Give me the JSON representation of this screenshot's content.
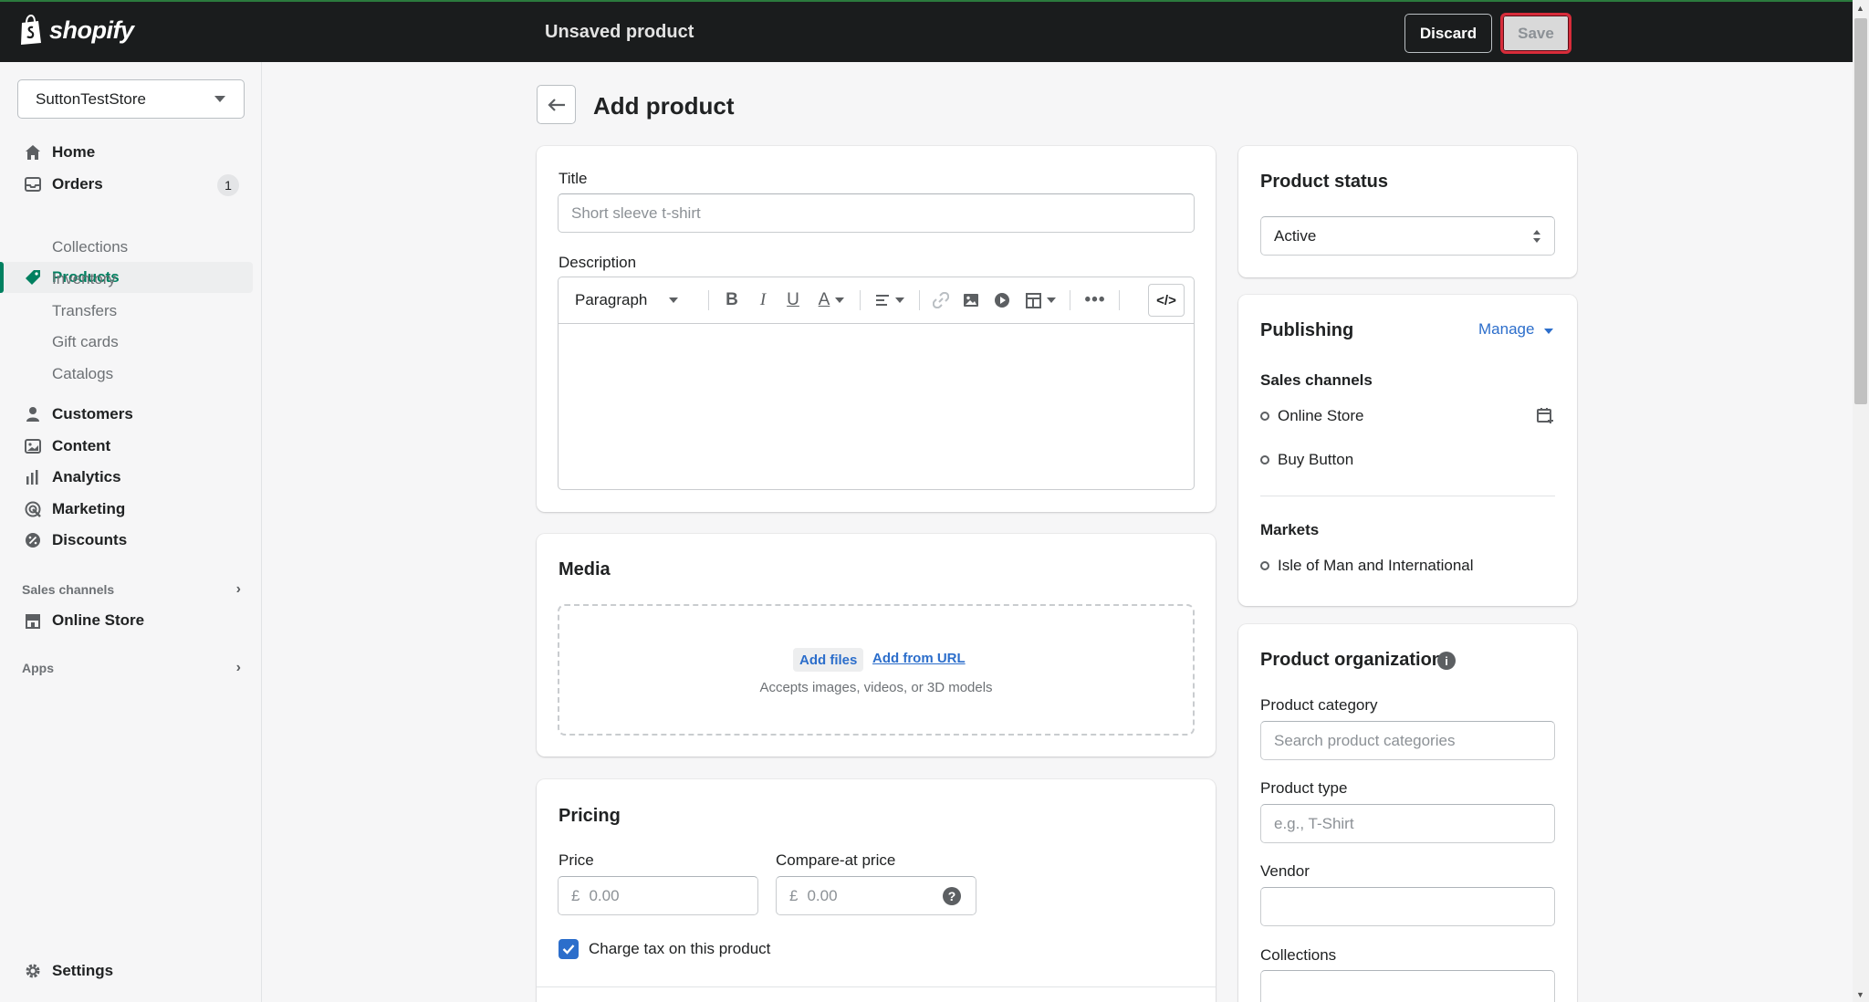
{
  "topbar": {
    "brand": "shopify",
    "title": "Unsaved product",
    "discard_label": "Discard",
    "save_label": "Save"
  },
  "sidebar": {
    "store_name": "SuttonTestStore",
    "items": [
      {
        "label": "Home",
        "icon": "home-icon"
      },
      {
        "label": "Orders",
        "icon": "orders-icon",
        "badge": "1"
      },
      {
        "label": "Products",
        "icon": "tag-icon"
      },
      {
        "label": "Customers",
        "icon": "person-icon"
      },
      {
        "label": "Content",
        "icon": "content-icon"
      },
      {
        "label": "Analytics",
        "icon": "bar-chart-icon"
      },
      {
        "label": "Marketing",
        "icon": "target-icon"
      },
      {
        "label": "Discounts",
        "icon": "discount-icon"
      }
    ],
    "product_subitems": [
      "Collections",
      "Inventory",
      "Transfers",
      "Gift cards",
      "Catalogs"
    ],
    "sales_channels_heading": "Sales channels",
    "online_store": "Online Store",
    "apps_heading": "Apps",
    "settings": "Settings"
  },
  "page": {
    "title": "Add product"
  },
  "product_form": {
    "title_label": "Title",
    "title_placeholder": "Short sleeve t-shirt",
    "description_label": "Description",
    "paragraph_select": "Paragraph",
    "media_title": "Media",
    "add_files": "Add files",
    "add_from_url": "Add from URL",
    "media_hint": "Accepts images, videos, or 3D models",
    "pricing_title": "Pricing",
    "price_label": "Price",
    "compare_label": "Compare-at price",
    "currency": "£",
    "price_placeholder": "0.00",
    "compare_placeholder": "0.00",
    "charge_tax_label": "Charge tax on this product",
    "charge_tax_checked": true
  },
  "status_card": {
    "title": "Product status",
    "value": "Active"
  },
  "publishing": {
    "title": "Publishing",
    "manage": "Manage",
    "sales_channels_heading": "Sales channels",
    "channels": [
      "Online Store",
      "Buy Button"
    ],
    "markets_heading": "Markets",
    "markets": [
      "Isle of Man and International"
    ]
  },
  "organization": {
    "title": "Product organization",
    "category_label": "Product category",
    "category_placeholder": "Search product categories",
    "type_label": "Product type",
    "type_placeholder": "e.g., T-Shirt",
    "vendor_label": "Vendor",
    "vendor_value": "",
    "collections_label": "Collections"
  },
  "colors": {
    "topbar": "#1a1c1d",
    "accent_green": "#008060",
    "link_blue": "#2c6ecb",
    "save_highlight": "#d72c3a"
  }
}
